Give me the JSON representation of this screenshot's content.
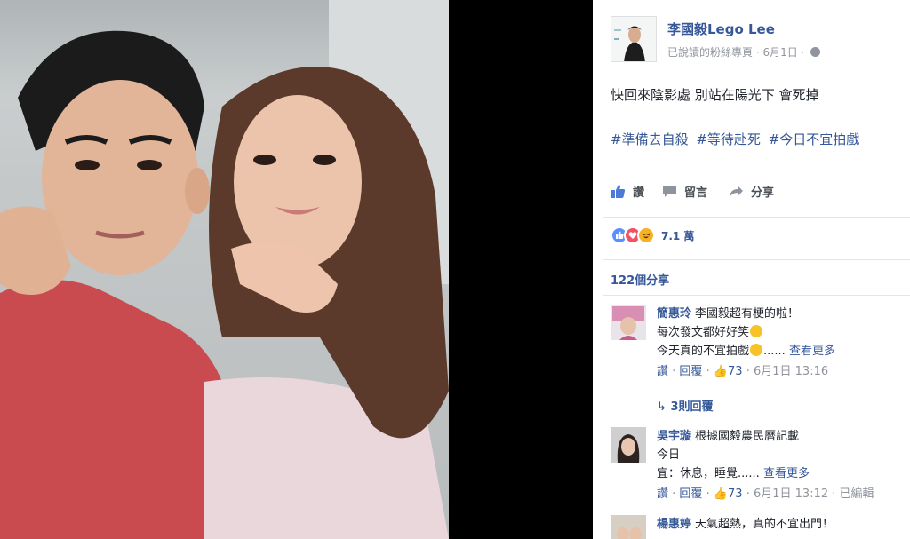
{
  "page": {
    "name": "李國毅Lego Lee",
    "meta": "已說讀的粉絲專頁 · 6月1日 ·"
  },
  "post": {
    "text": "快回來陰影處 別站在陽光下 會死掉",
    "hashtags": [
      "#準備去自殺",
      "#等待赴死",
      "#今日不宜拍戲"
    ]
  },
  "actions": {
    "like": "讚",
    "comment": "留言",
    "share": "分享"
  },
  "reactions": {
    "count": "7.1 萬"
  },
  "shares": {
    "label": "122個分享"
  },
  "comments": [
    {
      "author": "簡惠玲",
      "lines": [
        "李國毅超有梗的啦！",
        "每次發文都好好笑",
        "今天真的不宜拍戲"
      ],
      "ellipsis": "......",
      "more": "查看更多",
      "meta_like": "讚",
      "meta_reply": "回覆",
      "likes": "73",
      "time": "6月1日 13:16",
      "replies": "3則回覆"
    },
    {
      "author": "吳宇璇",
      "lines": [
        "根據國毅農民曆記載",
        "今日",
        "宜：休息，睡覺......"
      ],
      "more": "查看更多",
      "meta_like": "讚",
      "meta_reply": "回覆",
      "likes": "73",
      "time": "6月1日 13:12",
      "edited": "已編輯"
    },
    {
      "author": "楊惠婷",
      "lines": [
        "天氣超熱，真的不宜出門！"
      ]
    }
  ],
  "colors": {
    "link": "#365899",
    "text": "#1d2129",
    "muted": "#90949c",
    "like_reaction": "#5890ff",
    "love_reaction": "#f25268",
    "haha_reaction": "#f7b125"
  }
}
